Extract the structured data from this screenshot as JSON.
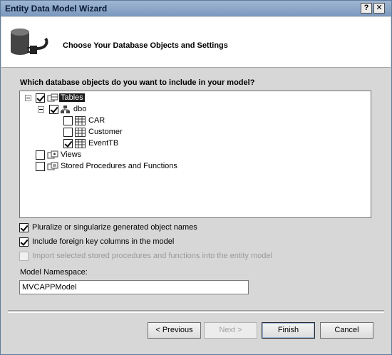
{
  "window": {
    "title": "Entity Data Model Wizard",
    "help_glyph": "?",
    "close_glyph": "✕"
  },
  "header": {
    "text": "Choose Your Database Objects and Settings",
    "icon": "database-plug-icon"
  },
  "tree": {
    "question": "Which database objects do you want to include in your model?",
    "nodes": [
      {
        "label": "Tables",
        "checked": true,
        "expanded": true,
        "selected": true,
        "icon": "tables-folder-icon"
      },
      {
        "label": "dbo",
        "checked": true,
        "expanded": true,
        "icon": "schema-icon"
      },
      {
        "label": "CAR",
        "checked": false,
        "icon": "table-icon"
      },
      {
        "label": "Customer",
        "checked": false,
        "icon": "table-icon"
      },
      {
        "label": "EventTB",
        "checked": true,
        "icon": "table-icon"
      },
      {
        "label": "Views",
        "checked": false,
        "icon": "views-folder-icon"
      },
      {
        "label": "Stored Procedures and Functions",
        "checked": false,
        "icon": "procedures-folder-icon"
      }
    ]
  },
  "options": {
    "pluralize": {
      "label": "Pluralize or singularize generated object names",
      "checked": true
    },
    "foreign_keys": {
      "label": "Include foreign key columns in the model",
      "checked": true
    },
    "import_procs": {
      "label": "Import selected stored procedures and functions into the entity model",
      "checked": false,
      "disabled": true
    }
  },
  "namespace": {
    "label": "Model Namespace:",
    "value": "MVCAPPModel"
  },
  "buttons": {
    "previous": "< Previous",
    "next": "Next >",
    "finish": "Finish",
    "cancel": "Cancel"
  }
}
